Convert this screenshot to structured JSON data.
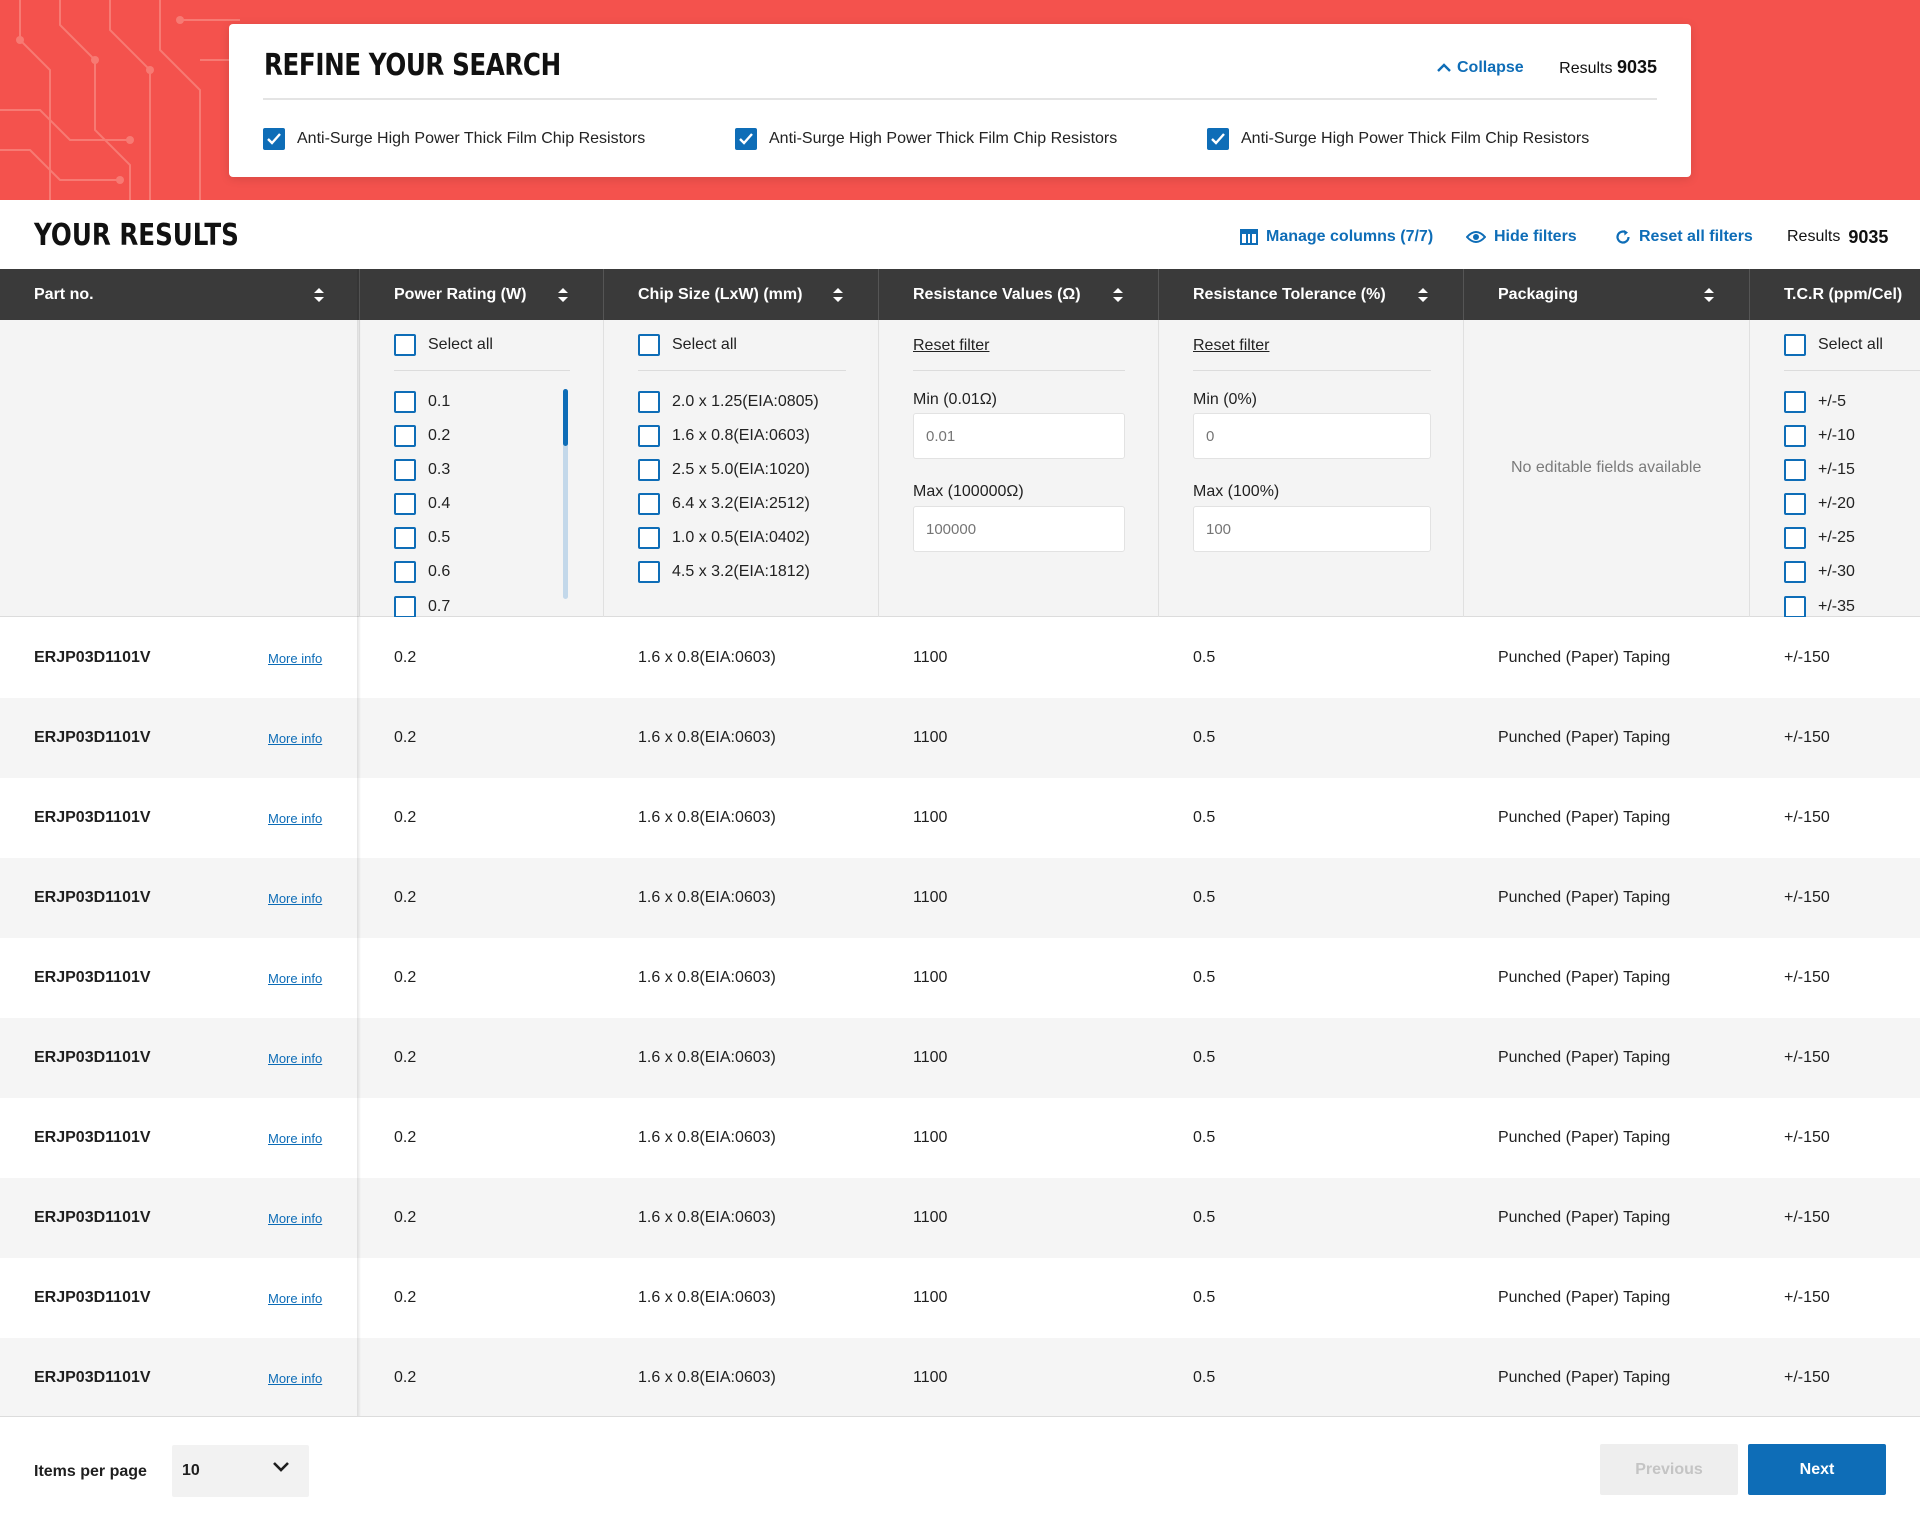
{
  "refine": {
    "title": "REFINE YOUR SEARCH",
    "collapse_label": "Collapse",
    "results_label": "Results",
    "results_count": "9035",
    "chips": [
      {
        "label": "Anti-Surge High Power Thick Film Chip Resistors",
        "checked": true
      },
      {
        "label": "Anti-Surge High Power Thick Film Chip Resistors",
        "checked": true
      },
      {
        "label": "Anti-Surge High Power Thick Film Chip Resistors",
        "checked": true
      }
    ]
  },
  "results_header": {
    "title": "YOUR RESULTS",
    "manage_columns": "Manage columns (7/7)",
    "hide_filters": "Hide filters",
    "reset_all_filters": "Reset all filters",
    "results_label": "Results",
    "results_count": "9035"
  },
  "columns": [
    {
      "label": "Part no."
    },
    {
      "label": "Power Rating (W)"
    },
    {
      "label": "Chip Size (LxW) (mm)"
    },
    {
      "label": "Resistance Values (Ω)"
    },
    {
      "label": "Resistance Tolerance (%)"
    },
    {
      "label": "Packaging"
    },
    {
      "label": "T.C.R (ppm/Cel)"
    }
  ],
  "filters": {
    "select_all": "Select all",
    "power_rating_options": [
      "0.1",
      "0.2",
      "0.3",
      "0.4",
      "0.5",
      "0.6",
      "0.7"
    ],
    "chip_size_options": [
      "2.0 x 1.25(EIA:0805)",
      "1.6 x 0.8(EIA:0603)",
      "2.5 x 5.0(EIA:1020)",
      "6.4 x 3.2(EIA:2512)",
      "1.0 x 0.5(EIA:0402)",
      "4.5 x 3.2(EIA:1812)"
    ],
    "resistance": {
      "reset_label": "Reset filter",
      "min_label": "Min (0.01Ω)",
      "min_placeholder": "0.01",
      "max_label": "Max (100000Ω)",
      "max_placeholder": "100000"
    },
    "tolerance": {
      "reset_label": "Reset filter",
      "min_label": "Min (0%)",
      "min_placeholder": "0",
      "max_label": "Max (100%)",
      "max_placeholder": "100"
    },
    "packaging_empty": "No editable fields available",
    "tcr_options": [
      "+/-5",
      "+/-10",
      "+/-15",
      "+/-20",
      "+/-25",
      "+/-30",
      "+/-35"
    ]
  },
  "rows": [
    {
      "part_no": "ERJP03D1101V",
      "more_info": "More info",
      "power": "0.2",
      "chip_size": "1.6 x 0.8(EIA:0603)",
      "resistance": "1100",
      "tolerance": "0.5",
      "packaging": "Punched (Paper) Taping",
      "tcr": "+/-150"
    },
    {
      "part_no": "ERJP03D1101V",
      "more_info": "More info",
      "power": "0.2",
      "chip_size": "1.6 x 0.8(EIA:0603)",
      "resistance": "1100",
      "tolerance": "0.5",
      "packaging": "Punched (Paper) Taping",
      "tcr": "+/-150"
    },
    {
      "part_no": "ERJP03D1101V",
      "more_info": "More info",
      "power": "0.2",
      "chip_size": "1.6 x 0.8(EIA:0603)",
      "resistance": "1100",
      "tolerance": "0.5",
      "packaging": "Punched (Paper) Taping",
      "tcr": "+/-150"
    },
    {
      "part_no": "ERJP03D1101V",
      "more_info": "More info",
      "power": "0.2",
      "chip_size": "1.6 x 0.8(EIA:0603)",
      "resistance": "1100",
      "tolerance": "0.5",
      "packaging": "Punched (Paper) Taping",
      "tcr": "+/-150"
    },
    {
      "part_no": "ERJP03D1101V",
      "more_info": "More info",
      "power": "0.2",
      "chip_size": "1.6 x 0.8(EIA:0603)",
      "resistance": "1100",
      "tolerance": "0.5",
      "packaging": "Punched (Paper) Taping",
      "tcr": "+/-150"
    },
    {
      "part_no": "ERJP03D1101V",
      "more_info": "More info",
      "power": "0.2",
      "chip_size": "1.6 x 0.8(EIA:0603)",
      "resistance": "1100",
      "tolerance": "0.5",
      "packaging": "Punched (Paper) Taping",
      "tcr": "+/-150"
    },
    {
      "part_no": "ERJP03D1101V",
      "more_info": "More info",
      "power": "0.2",
      "chip_size": "1.6 x 0.8(EIA:0603)",
      "resistance": "1100",
      "tolerance": "0.5",
      "packaging": "Punched (Paper) Taping",
      "tcr": "+/-150"
    },
    {
      "part_no": "ERJP03D1101V",
      "more_info": "More info",
      "power": "0.2",
      "chip_size": "1.6 x 0.8(EIA:0603)",
      "resistance": "1100",
      "tolerance": "0.5",
      "packaging": "Punched (Paper) Taping",
      "tcr": "+/-150"
    },
    {
      "part_no": "ERJP03D1101V",
      "more_info": "More info",
      "power": "0.2",
      "chip_size": "1.6 x 0.8(EIA:0603)",
      "resistance": "1100",
      "tolerance": "0.5",
      "packaging": "Punched (Paper) Taping",
      "tcr": "+/-150"
    },
    {
      "part_no": "ERJP03D1101V",
      "more_info": "More info",
      "power": "0.2",
      "chip_size": "1.6 x 0.8(EIA:0603)",
      "resistance": "1100",
      "tolerance": "0.5",
      "packaging": "Punched (Paper) Taping",
      "tcr": "+/-150"
    }
  ],
  "footer": {
    "items_per_page_label": "Items per page",
    "items_per_page_value": "10",
    "previous_label": "Previous",
    "next_label": "Next"
  },
  "colors": {
    "hero_red": "#f4524d",
    "accent_blue": "#0e6db7",
    "table_header": "#3a3a3a"
  }
}
